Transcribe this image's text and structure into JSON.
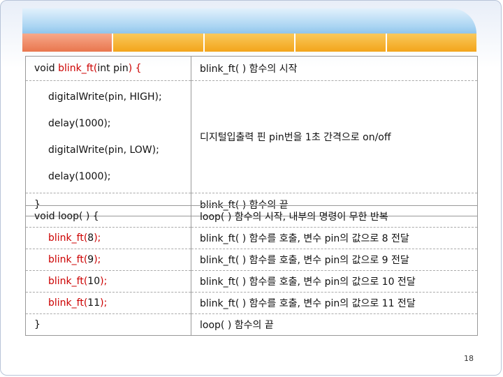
{
  "table1": {
    "rows": [
      {
        "code_prefix": "void ",
        "code_fn": "blink_ft",
        "code_paren": "(",
        "code_args": "int pin",
        "code_close": ") {",
        "desc": "blink_ft( ) 함수의 시작"
      },
      {
        "code_lines": [
          "digitalWrite(pin, HIGH);",
          "delay(1000);",
          "digitalWrite(pin, LOW);",
          "delay(1000);"
        ],
        "desc": "디지털입출력 핀 pin번을 1초 간격으로 on/off"
      },
      {
        "code": "}",
        "desc": "blink_ft( ) 함수의 끝"
      }
    ]
  },
  "table2": {
    "rows": [
      {
        "code": "void loop( ) {",
        "desc": "loop( ) 함수의 시작, 내부의 명령이 무한 반복"
      },
      {
        "fn": "blink_ft",
        "open": "(",
        "arg": "8",
        "close": ");",
        "desc": "blink_ft( ) 함수를 호출, 변수 pin의 값으로 8 전달"
      },
      {
        "fn": "blink_ft",
        "open": "(",
        "arg": "9",
        "close": ");",
        "desc": "blink_ft( ) 함수를 호출, 변수 pin의 값으로 9 전달"
      },
      {
        "fn": "blink_ft",
        "open": "(",
        "arg": "10",
        "close": ");",
        "desc": "blink_ft( ) 함수를 호출, 변수 pin의 값으로 10 전달"
      },
      {
        "fn": "blink_ft",
        "open": "(",
        "arg": "11",
        "close": ");",
        "desc": "blink_ft( ) 함수를 호출, 변수 pin의 값으로 11 전달"
      },
      {
        "code": "}",
        "desc": "loop( ) 함수의 끝"
      }
    ]
  },
  "page_number": "18",
  "colors": {
    "accent_red": "#cc0000",
    "banner_blue": "#6fb1e4",
    "tab_orange": "#f3a51b"
  }
}
